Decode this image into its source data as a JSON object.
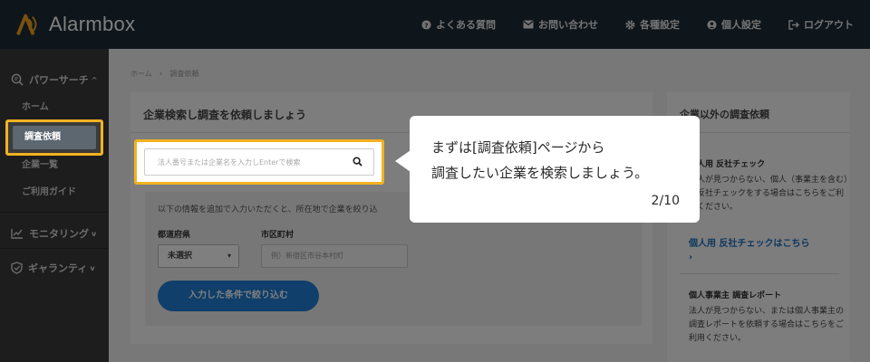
{
  "header": {
    "app_name": "Alarmbox",
    "nav": [
      {
        "label": "よくある質問",
        "icon": "question-circle-icon"
      },
      {
        "label": "お問い合わせ",
        "icon": "envelope-icon"
      },
      {
        "label": "各種設定",
        "icon": "gear-icon"
      },
      {
        "label": "個人設定",
        "icon": "user-circle-icon"
      },
      {
        "label": "ログアウト",
        "icon": "logout-icon"
      }
    ]
  },
  "sidebar": {
    "section_power": {
      "label": "パワーサーチ",
      "icon": "search-doc-icon",
      "chevron": "^"
    },
    "items": [
      {
        "label": "ホーム"
      },
      {
        "label": "調査依頼"
      },
      {
        "label": "企業一覧"
      },
      {
        "label": "ご利用ガイド"
      }
    ],
    "section_monitoring": {
      "label": "モニタリング",
      "icon": "chart-line-icon",
      "chevron": "v"
    },
    "section_guarantee": {
      "label": "ギャランティ",
      "icon": "shield-icon",
      "chevron": "v"
    }
  },
  "breadcrumb": {
    "home": "ホーム",
    "sep": "›",
    "current": "調査依頼"
  },
  "main": {
    "title": "企業検索し調査を依頼しましょう",
    "search_placeholder": "法人番号または企業名を入力しEnterで検索",
    "filter_desc": "以下の情報を追加で入力いただくと、所在地で企業を絞り込",
    "prefecture_label": "都道府県",
    "prefecture_value": "未選択",
    "city_label": "市区町村",
    "city_placeholder": "例）新宿区市谷本村町",
    "filter_button": "入力した条件で絞り込む"
  },
  "side_panel": {
    "title": "企業以外の調査依頼",
    "block1": {
      "heading": "個人用 反社チェック",
      "body": "法人が見つからない、個人（事業主を含む）の反社チェックをする場合はこちらをご利用ください。",
      "link": "個人用 反社チェックはこちら",
      "link_arrow": "›"
    },
    "block2": {
      "heading": "個人事業主 調査レポート",
      "body": "法人が見つからない、または個人事業主の調査レポートを依頼する場合はこちらをご利用ください。"
    }
  },
  "tooltip": {
    "line1": "まずは[調査依頼]ページから",
    "line2": "調査したい企業を検索しましょう。",
    "step": "2/10"
  },
  "colors": {
    "header_bg": "#1c2b36",
    "sidebar_bg": "#3b3b3b",
    "highlight": "#f2b21f",
    "primary_button": "#1f7fd4",
    "link": "#1f6fbf"
  }
}
